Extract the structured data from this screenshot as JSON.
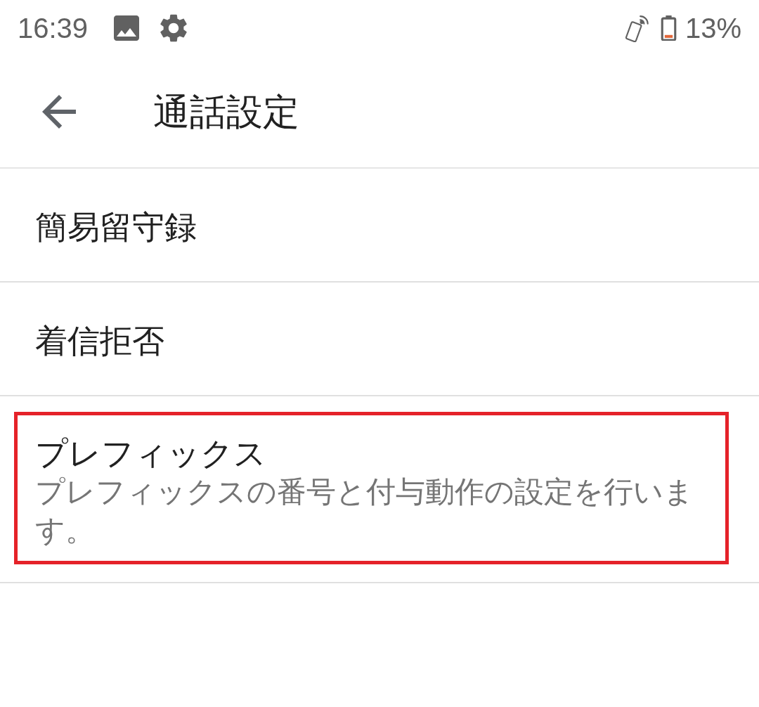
{
  "status_bar": {
    "time": "16:39",
    "battery": "13%"
  },
  "app_bar": {
    "title": "通話設定"
  },
  "items": [
    {
      "title": "簡易留守録",
      "highlighted": false
    },
    {
      "title": "着信拒否",
      "highlighted": false
    },
    {
      "title": "プレフィックス",
      "summary": "プレフィックスの番号と付与動作の設定を行います。",
      "highlighted": true
    }
  ]
}
